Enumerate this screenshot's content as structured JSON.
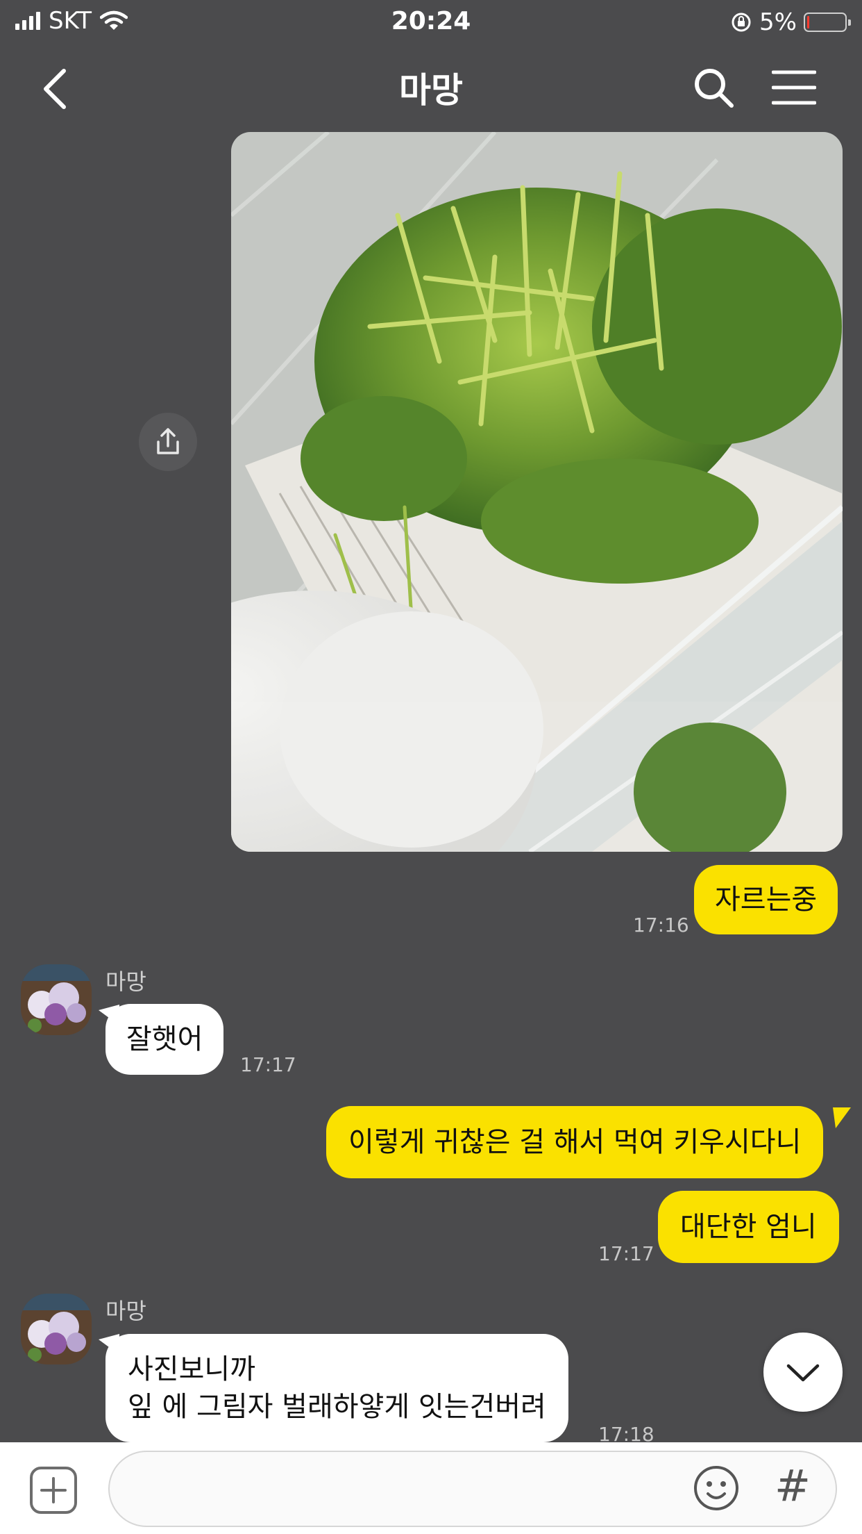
{
  "status_bar": {
    "carrier": "SKT",
    "time": "20:24",
    "battery": "5%",
    "battery_level": 0.05
  },
  "header": {
    "title": "마망"
  },
  "messages": [
    {
      "type": "image",
      "from": "me",
      "icon": "photo-of-cut-greens"
    },
    {
      "from": "me",
      "text": "자르는중",
      "time": "17:16"
    },
    {
      "from": "other",
      "sender": "마망",
      "text": "잘햇어",
      "time": "17:17"
    },
    {
      "from": "me",
      "text": "이렇게 귀찮은 걸 해서 먹여 키우시다니"
    },
    {
      "from": "me",
      "text": "대단한 엄니",
      "time": "17:17"
    },
    {
      "from": "other",
      "sender": "마망",
      "lines": [
        "사진보니까",
        "잎 에 그림자 벌래하얗게 잇는건버려"
      ],
      "time": "17:18"
    }
  ],
  "input": {
    "placeholder": ""
  },
  "colors": {
    "background": "#4b4b4d",
    "my_bubble": "#fae100",
    "their_bubble": "#ffffff"
  }
}
